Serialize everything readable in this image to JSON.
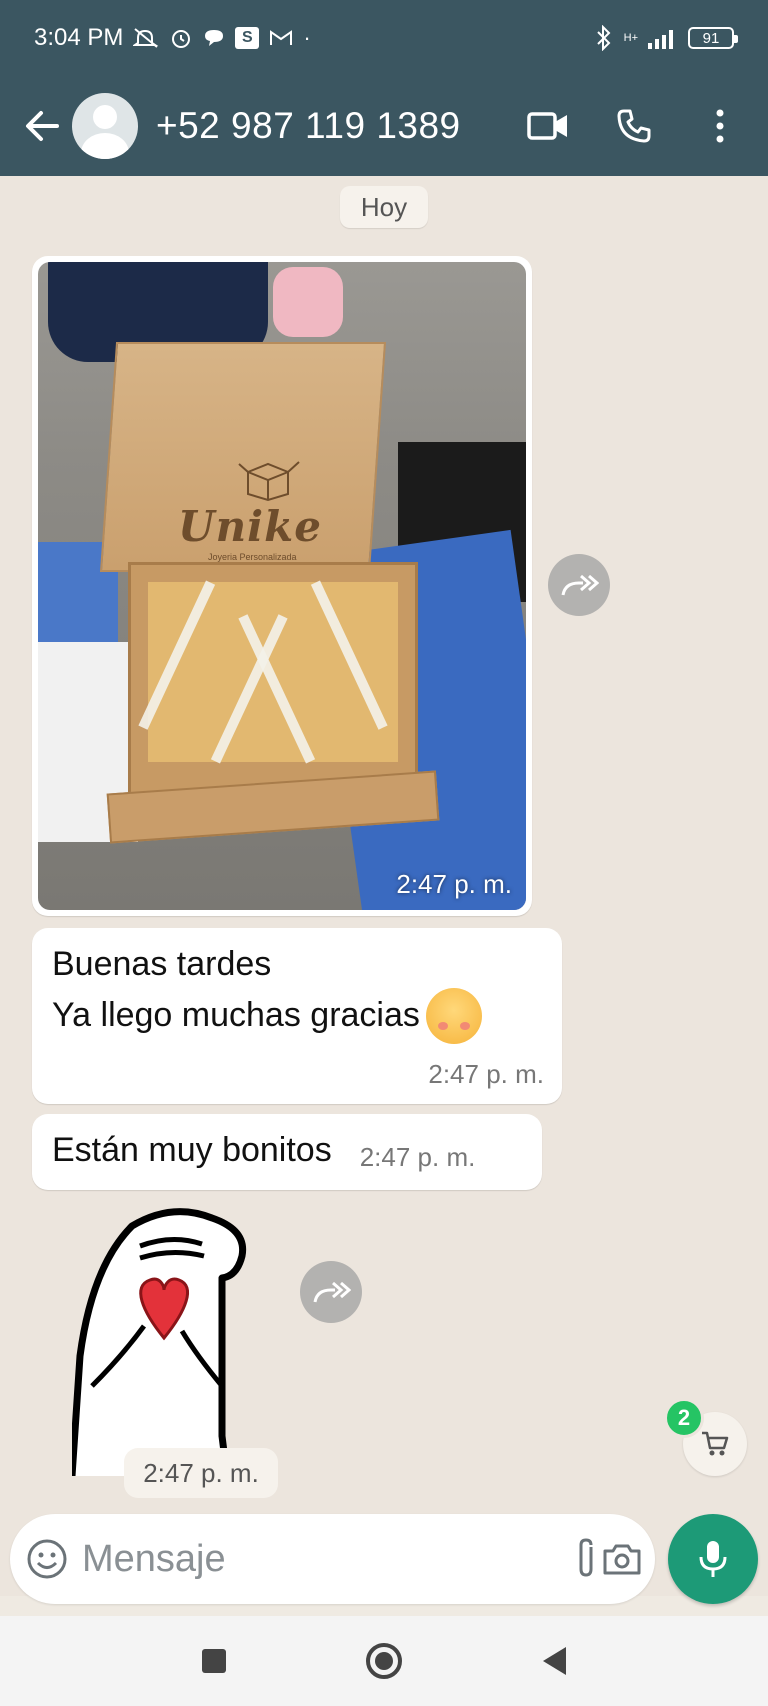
{
  "status_bar": {
    "time": "3:04 PM",
    "network": "H+",
    "battery": "91"
  },
  "header": {
    "contact_name": "+52 987 119 1389",
    "icons": [
      "back-arrow-icon",
      "video-call-icon",
      "phone-icon",
      "more-vert-icon"
    ]
  },
  "chat": {
    "day_label": "Hoy",
    "messages": [
      {
        "type": "image",
        "brand_text": "Unike",
        "brand_subtext": "Joyeria Personalizada",
        "time": "2:47 p. m."
      },
      {
        "type": "text",
        "lines": [
          "Buenas tardes",
          "Ya llego muchas gracias"
        ],
        "time": "2:47 p. m."
      },
      {
        "type": "text",
        "text": "Están muy bonitos",
        "time": "2:47 p. m."
      },
      {
        "type": "sticker",
        "time": "2:47 p. m."
      }
    ],
    "cart_badge": "2"
  },
  "composer": {
    "placeholder": "Mensaje"
  },
  "colors": {
    "header": "#3b5661",
    "chat_bg": "#ece5dd",
    "mic_button": "#1d9a77",
    "badge": "#25c464"
  }
}
